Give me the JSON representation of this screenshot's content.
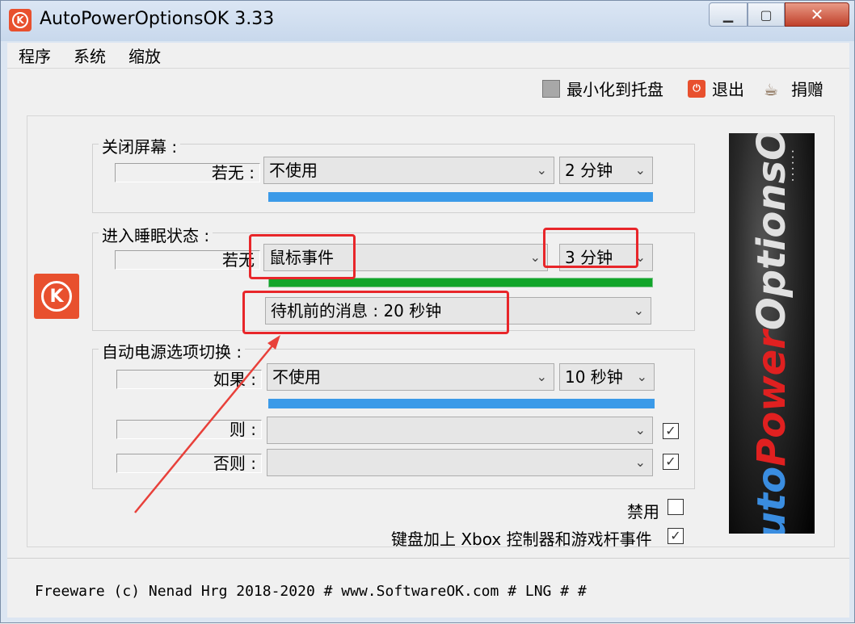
{
  "window": {
    "title": "AutoPowerOptionsOK 3.33",
    "icon": "autopoweroptionsok-logo-icon",
    "controls": [
      "minimize",
      "maximize",
      "close"
    ]
  },
  "menu": {
    "items": [
      "程序",
      "系统",
      "缩放"
    ]
  },
  "toolbar": {
    "minimize_to_tray": "最小化到托盘",
    "exit": "退出",
    "donate": "捐赠"
  },
  "groups": {
    "screen_off": {
      "label": "关闭屏幕 :",
      "condition_label": "若无 :",
      "event_value": "不使用",
      "time_value": "2 分钟",
      "bar_color": "#3b9ae8"
    },
    "sleep": {
      "label": "进入睡眠状态 :",
      "condition_label": "若无",
      "event_value": "鼠标事件",
      "time_value": "3 分钟",
      "bar_color": "#12a52a",
      "message_value": "待机前的消息 : 20 秒钟"
    },
    "auto_switch": {
      "label": "自动电源选项切换 :",
      "if_label": "如果 :",
      "if_value": "不使用",
      "if_time": "10 秒钟",
      "bar_color": "#3b9ae8",
      "then_label": "则 :",
      "then_value": "",
      "then_checked": "✓",
      "else_label": "否则 :",
      "else_value": "",
      "else_checked": "✓"
    }
  },
  "options": {
    "disable_label": "禁用",
    "disable_checked": "",
    "keyboard_label": "键盘加上 Xbox 控制器和游戏杆事件",
    "keyboard_checked": "✓"
  },
  "banner": {
    "part1": "Auto",
    "part2": "Power",
    "part3": "OptionsOK",
    "dots": "......"
  },
  "status": {
    "text": "Freeware (c) Nenad Hrg 2018-2020 # www.SoftwareOK.com   # LNG   #    #"
  },
  "annotations": {
    "highlight_color": "#e8262a"
  }
}
